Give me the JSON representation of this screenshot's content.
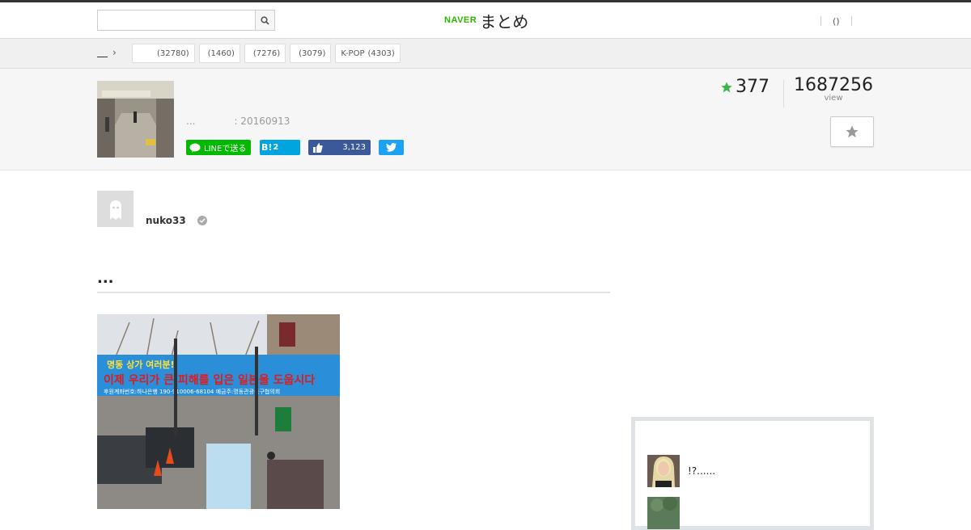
{
  "header": {
    "search_placeholder": "",
    "logo_naver": "NAVER",
    "logo_matome": "まとめ",
    "link_mypage": "()",
    "link_login": ""
  },
  "breadcrumb": {
    "home": "",
    "categories": [
      {
        "name": "",
        "count": "(32780)"
      },
      {
        "name": "",
        "count": "(1460)"
      },
      {
        "name": "",
        "count": "(7276)"
      },
      {
        "name": "",
        "count": "(3079)"
      },
      {
        "name": "K-POP",
        "count": "(4303)"
      }
    ]
  },
  "matome": {
    "meta_prefix": "...",
    "updated": ": 20160913",
    "favorites": "377",
    "views": "1687256",
    "views_label": "view",
    "share": {
      "line": "LINEで送る",
      "hatena_icon": "B!",
      "hatena_count": "2",
      "facebook_count": "3,123"
    }
  },
  "author": {
    "name": "nuko33"
  },
  "content": {
    "heading": "...",
    "photo_banner_line1": "명동 상가 여러분!",
    "photo_banner_line2": "이제 우리가 큰 피해를 입은 일본을 도웁시다",
    "photo_banner_line3": "후원계좌번호:하나은행 190-910006-68104 예금주:명동관광특구협의회"
  },
  "sidebar": {
    "items": [
      {
        "text": "!?......"
      },
      {
        "text": ""
      }
    ]
  },
  "colors": {
    "naver_green": "#2db400",
    "line_green": "#00b900",
    "hatena_blue": "#00a4de",
    "facebook_blue": "#3b5998",
    "twitter_blue": "#1da1f2",
    "fav_star_green": "#3cb54a"
  }
}
